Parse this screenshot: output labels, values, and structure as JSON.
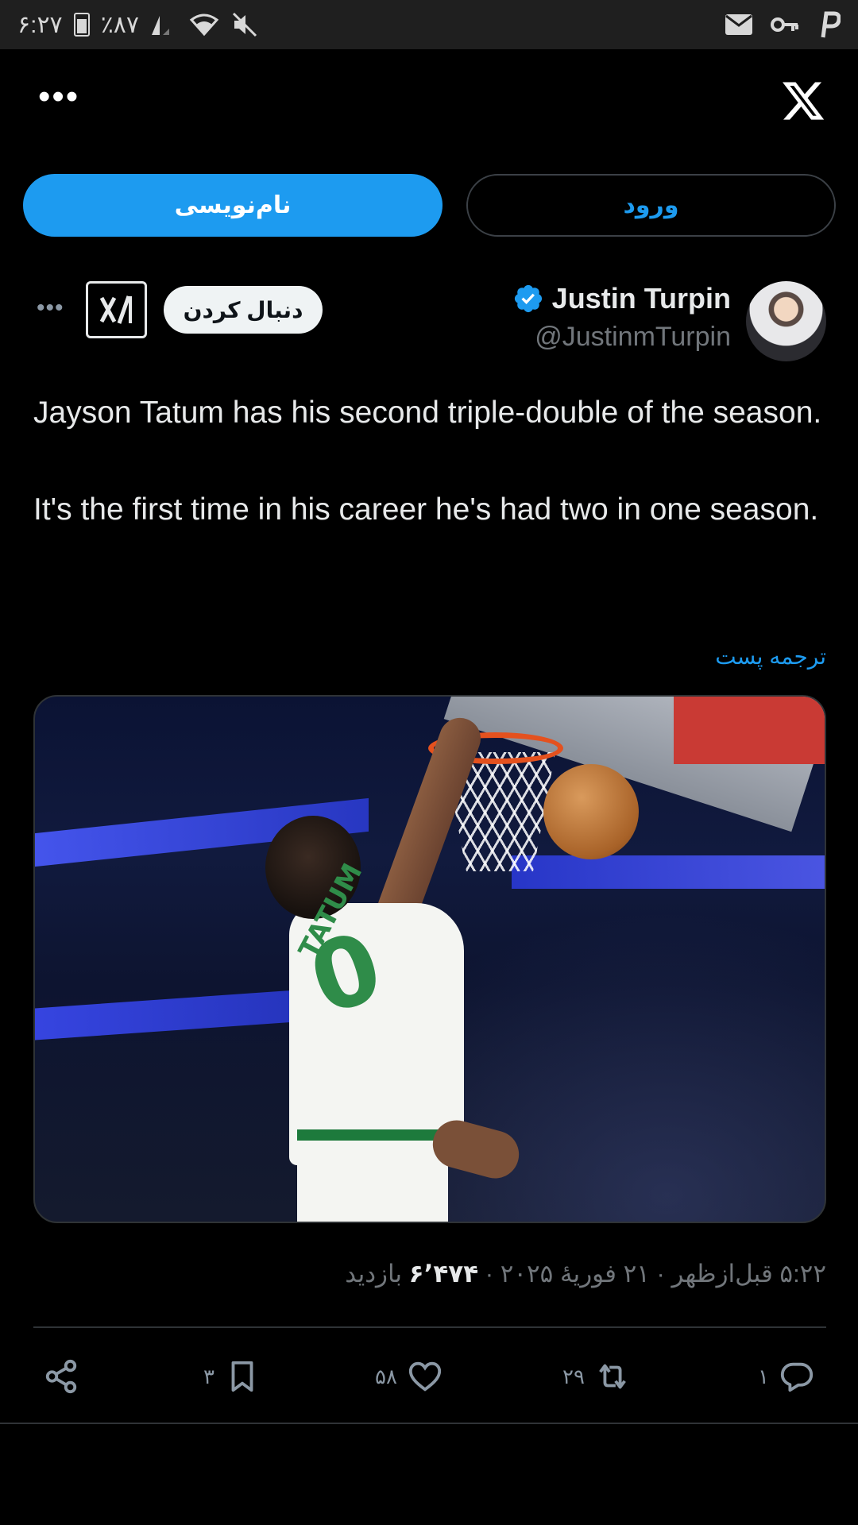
{
  "status_bar": {
    "time": "۶:۲۷",
    "battery": "٪۸۷",
    "icons": [
      "battery-icon",
      "signal-icon",
      "wifi-icon",
      "mute-icon",
      "mail-icon",
      "key-icon",
      "p-icon"
    ]
  },
  "topbar": {
    "more_label": "•••",
    "logo": "x-logo-icon"
  },
  "auth": {
    "signup_label": "نام‌نویسی",
    "login_label": "ورود"
  },
  "author": {
    "name": "Justin Turpin",
    "handle": "@JustinmTurpin",
    "follow_label": "دنبال کردن",
    "more_label": "•••"
  },
  "tweet": {
    "text": "Jayson Tatum has his second triple-double of the season.\n\nIt's the first time in his career he's had two in one season.",
    "translate_label": "ترجمه پست",
    "media_alt_jersey_name": "TATUM",
    "media_alt_jersey_number": "0"
  },
  "meta": {
    "time": "۵:۲۲ قبل‌ازظهر",
    "date": "۲۱ فوریهٔ ۲۰۲۵",
    "views_count": "۶٬۴۷۴",
    "views_label": "بازدید",
    "separator": "·"
  },
  "actions": {
    "reply_count": "۱",
    "retweet_count": "۲۹",
    "like_count": "۵۸",
    "bookmark_count": "۳"
  },
  "colors": {
    "accent": "#1d9bf0",
    "background": "#000000",
    "muted": "#71767b"
  }
}
